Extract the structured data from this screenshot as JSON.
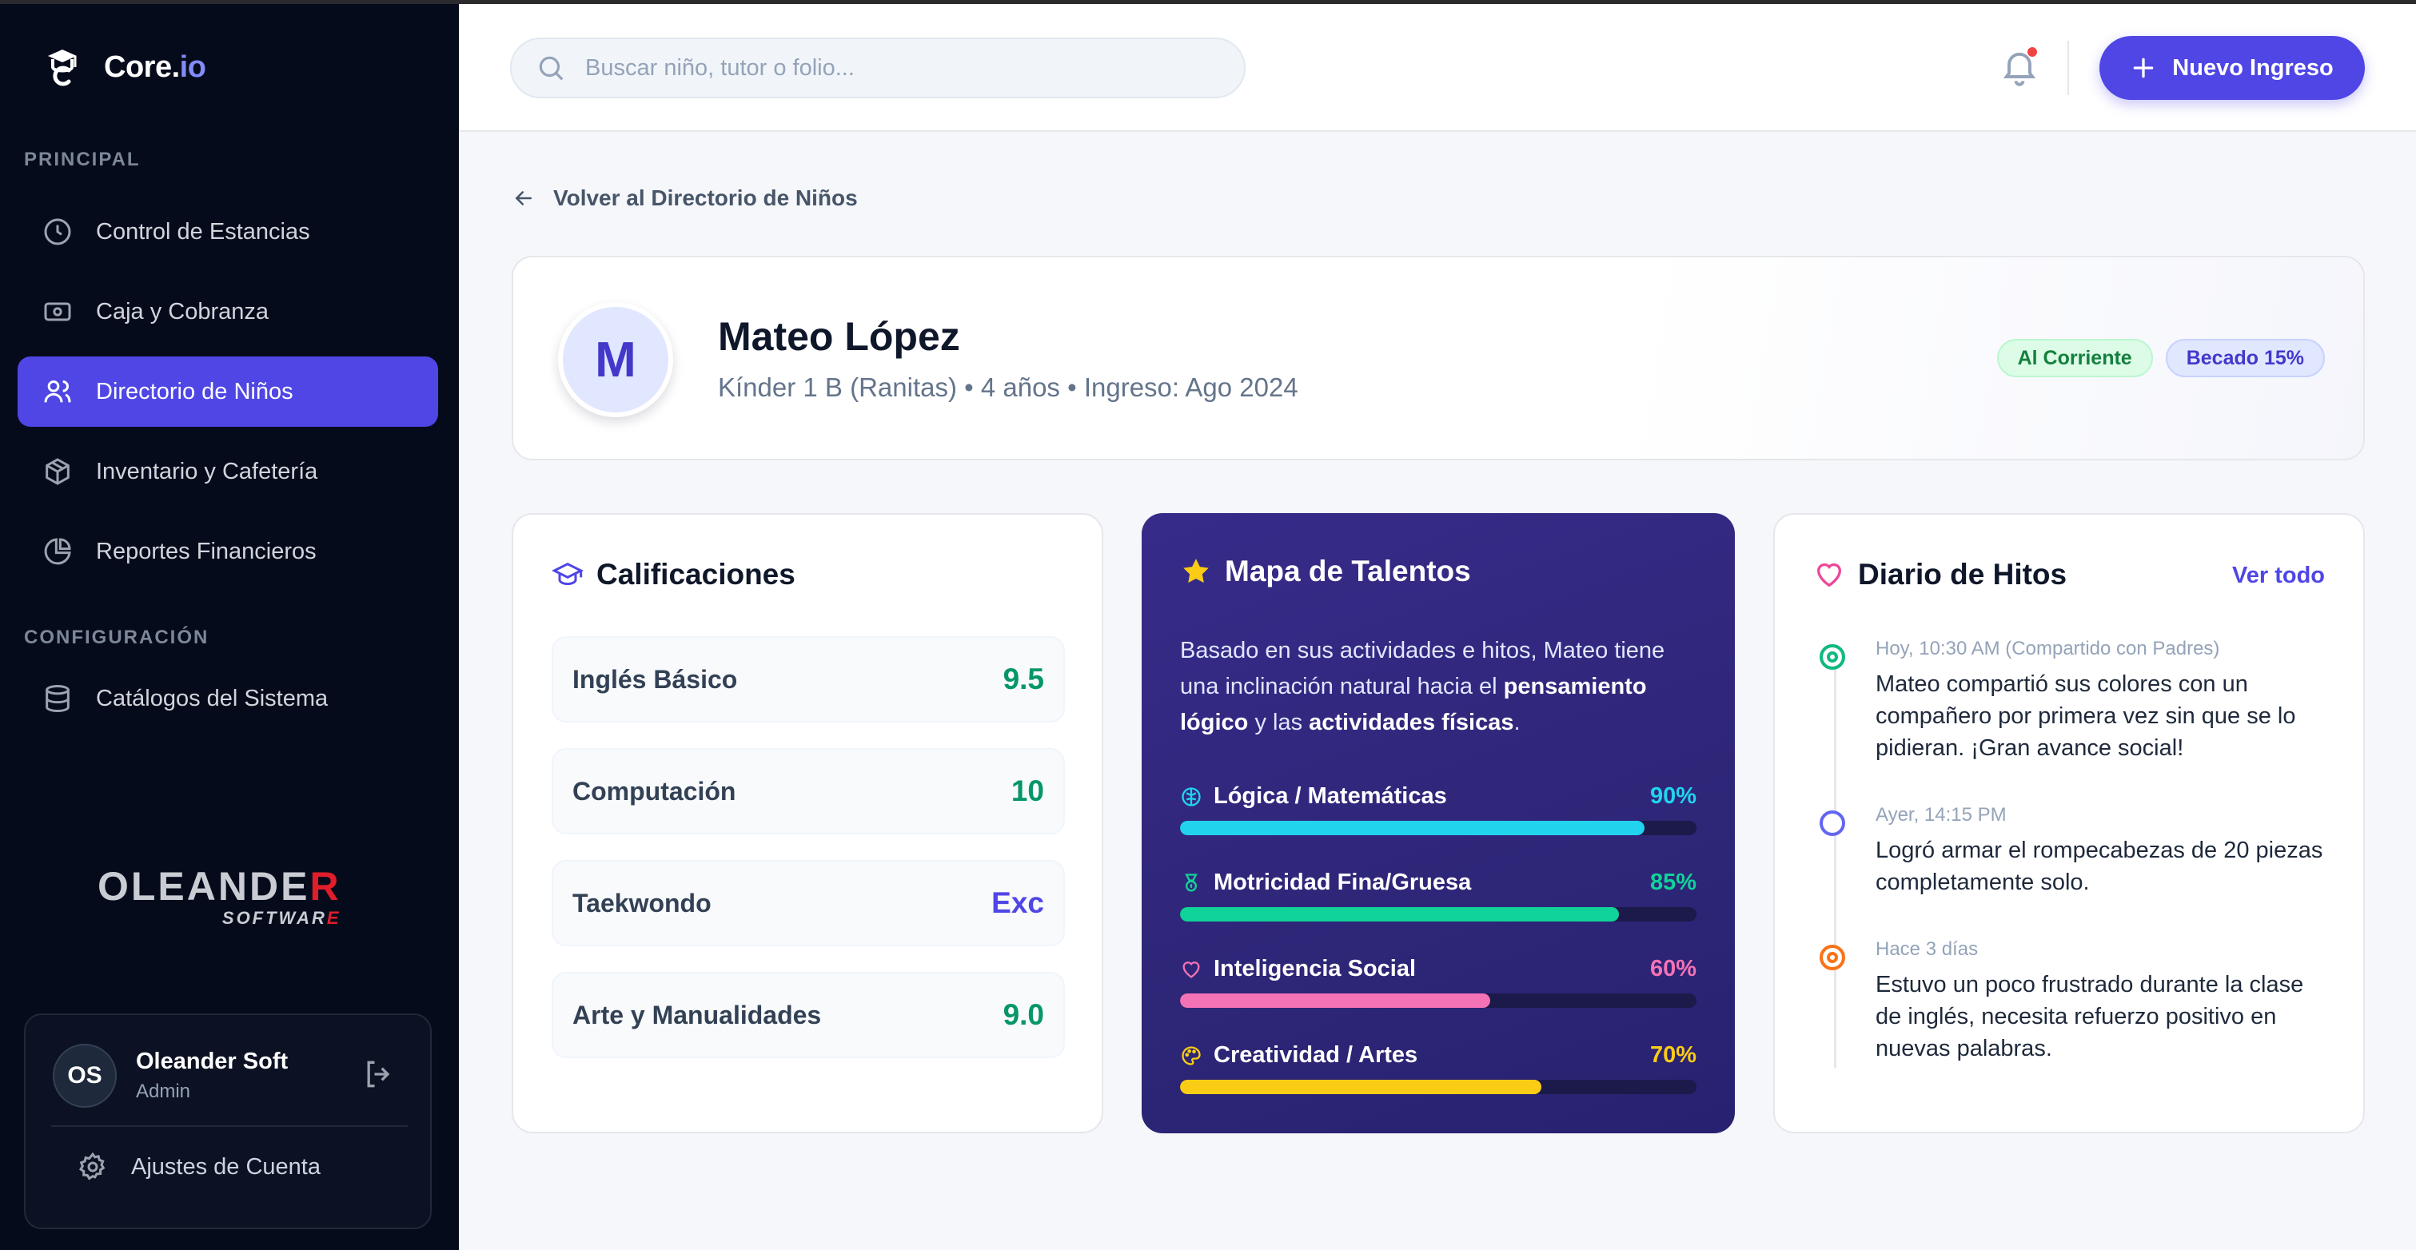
{
  "app": {
    "name_main": "Core.",
    "name_accent": "io"
  },
  "sidebar": {
    "section_principal": "PRINCIPAL",
    "section_config": "CONFIGURACIÓN",
    "items": [
      {
        "label": "Control de Estancias",
        "icon": "clock-icon"
      },
      {
        "label": "Caja y Cobranza",
        "icon": "banknote-icon"
      },
      {
        "label": "Directorio de Niños",
        "icon": "users-icon",
        "active": true
      },
      {
        "label": "Inventario y Cafetería",
        "icon": "package-icon"
      },
      {
        "label": "Reportes Financieros",
        "icon": "pie-chart-icon"
      }
    ],
    "config_items": [
      {
        "label": "Catálogos del Sistema",
        "icon": "database-icon"
      }
    ],
    "brand_big_pre": "OLEANDE",
    "brand_big_accent": "R",
    "brand_small_pre": "SOFTWAR",
    "brand_small_accent": "E",
    "user": {
      "initials": "OS",
      "name": "Oleander Soft",
      "role": "Admin",
      "settings_label": "Ajustes de Cuenta"
    }
  },
  "header": {
    "search_placeholder": "Buscar niño, tutor o folio...",
    "new_button_label": "Nuevo Ingreso"
  },
  "main": {
    "back_label": "Volver al Directorio de Niños",
    "profile": {
      "initial": "M",
      "name": "Mateo López",
      "meta": "Kínder 1 B (Ranitas) • 4 años • Ingreso: Ago 2024",
      "badges": [
        "Al Corriente",
        "Becado 15%"
      ]
    },
    "grades": {
      "title": "Calificaciones",
      "items": [
        {
          "subject": "Inglés Básico",
          "value": "9.5",
          "color": "#059669"
        },
        {
          "subject": "Computación",
          "value": "10",
          "color": "#059669"
        },
        {
          "subject": "Taekwondo",
          "value": "Exc",
          "color": "#4f46e5"
        },
        {
          "subject": "Arte y Manualidades",
          "value": "9.0",
          "color": "#059669"
        }
      ]
    },
    "talents": {
      "title": "Mapa de Talentos",
      "desc_1": "Basado en sus actividades e hitos, Mateo tiene una inclinación natural hacia el ",
      "desc_bold_1": "pensamiento lógico",
      "desc_2": " y las ",
      "desc_bold_2": "actividades físicas",
      "desc_3": ".",
      "items": [
        {
          "label": "Lógica / Matemáticas",
          "pct_label": "90%",
          "pct": 0.9,
          "color": "#22d3ee",
          "icon": "brain-icon"
        },
        {
          "label": "Motricidad Fina/Gruesa",
          "pct_label": "85%",
          "pct": 0.85,
          "color": "#10d39a",
          "icon": "medal-icon"
        },
        {
          "label": "Inteligencia Social",
          "pct_label": "60%",
          "pct": 0.6,
          "color": "#f472b6",
          "icon": "heart-icon"
        },
        {
          "label": "Creatividad / Artes",
          "pct_label": "70%",
          "pct": 0.7,
          "color": "#facc15",
          "icon": "palette-icon"
        }
      ]
    },
    "milestones": {
      "title": "Diario de Hitos",
      "see_all": "Ver todo",
      "items": [
        {
          "time": "Hoy, 10:30 AM (Compartido con Padres)",
          "text": "Mateo compartió sus colores con un compañero por primera vez sin que se lo pidieran. ¡Gran avance social!",
          "color": "#10b981"
        },
        {
          "time": "Ayer, 14:15 PM",
          "text": "Logró armar el rompecabezas de 20 piezas completamente solo.",
          "color": "#6366f1"
        },
        {
          "time": "Hace 3 días",
          "text": "Estuvo un poco frustrado durante la clase de inglés, necesita refuerzo positivo en nuevas palabras.",
          "color": "#f97316"
        }
      ]
    }
  }
}
